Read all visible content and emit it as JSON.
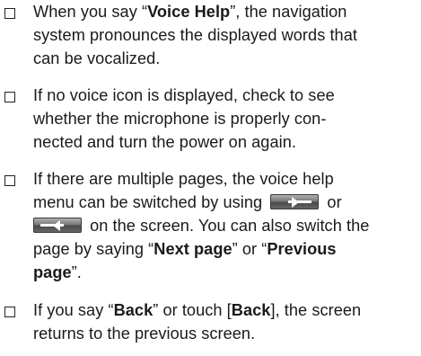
{
  "notes": [
    {
      "lines": [
        [
          "When you say “",
          {
            "bold": "Voice Help"
          },
          "”, the navigation"
        ],
        [
          "system pronounces the displayed words that"
        ],
        [
          "can be vocalized."
        ]
      ]
    },
    {
      "lines": [
        [
          "If no voice icon is displayed, check to see"
        ],
        [
          "whether the microphone is properly con-"
        ],
        [
          "nected and turn the power on again."
        ]
      ]
    },
    {
      "lines": [
        [
          "If there are multiple pages, the voice help"
        ],
        [
          "menu can be switched by using ",
          {
            "icon": "next-page-icon"
          },
          " or"
        ],
        [
          {
            "icon": "previous-page-icon"
          },
          " on the screen. You can also switch the"
        ],
        [
          "page by saying “",
          {
            "bold": "Next page"
          },
          "” or “",
          {
            "bold": "Previous"
          }
        ],
        [
          {
            "bold": "page"
          },
          "”."
        ]
      ]
    },
    {
      "lines": [
        [
          "If you say “",
          {
            "bold": "Back"
          },
          "” or touch [",
          {
            "bold": "Back"
          },
          "], the screen"
        ],
        [
          "returns to the previous screen."
        ]
      ]
    }
  ]
}
